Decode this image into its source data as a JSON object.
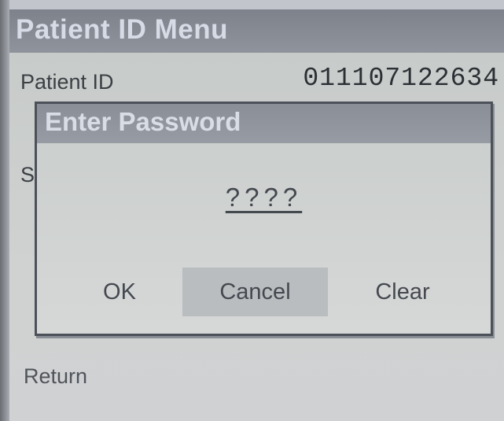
{
  "menu": {
    "title": "Patient ID Menu",
    "patient_id_label": "Patient ID",
    "patient_id_value": "011107122634",
    "partially_hidden_label": "S",
    "return_label": "Return"
  },
  "dialog": {
    "title": "Enter Password",
    "password_mask": "????",
    "buttons": {
      "ok": "OK",
      "cancel": "Cancel",
      "clear": "Clear"
    },
    "focused_button": "cancel"
  },
  "colors": {
    "titlebar": "#8a8e97",
    "title_text": "#d6dbe6",
    "background": "#cfd1d1",
    "focus_highlight": "#b9bdc0"
  }
}
